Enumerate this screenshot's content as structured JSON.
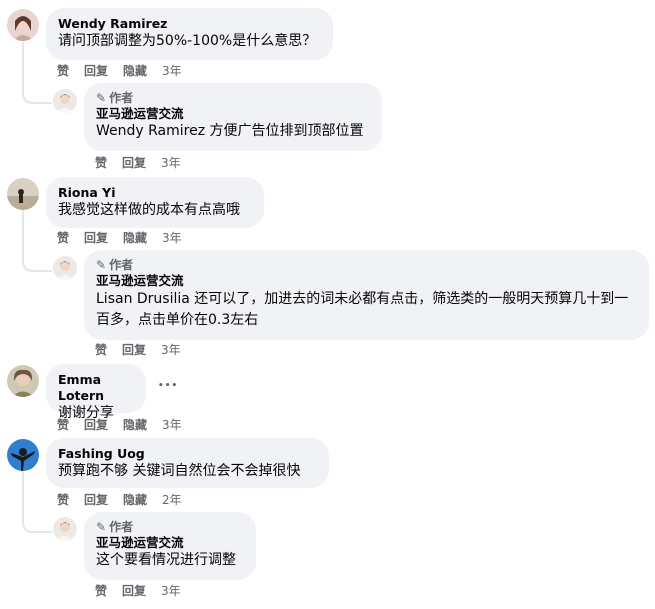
{
  "actions": {
    "like": "赞",
    "reply": "回复",
    "hide": "隐藏"
  },
  "author_badge": "作者",
  "comments": [
    {
      "name": "Wendy Ramirez",
      "text": "请问顶部调整为50%-100%是什么意思？",
      "time": "3年",
      "reply": {
        "name": "亚马逊运营交流",
        "mention": "Wendy Ramirez",
        "text": " 方便广告位排到顶部位置",
        "time": "3年"
      }
    },
    {
      "name": "Riona Yi",
      "text": "我感觉这样做的成本有点高哦",
      "time": "3年",
      "reply": {
        "name": "亚马逊运营交流",
        "mention": "Lisan Drusilia",
        "text": " 还可以了，加进去的词未必都有点击，筛选类的一般明天预算几十到一百多，点击单价在0.3左右",
        "time": "3年"
      }
    },
    {
      "name": "Emma Lotern",
      "text": "谢谢分享",
      "time": "3年",
      "more": "•••"
    },
    {
      "name": "Fashing Uog",
      "text": "预算跑不够 关键词自然位会不会掉很快",
      "time": "2年",
      "reply": {
        "name": "亚马逊运营交流",
        "mention": "",
        "text": "这个要看情况进行调整",
        "time": "3年"
      }
    }
  ]
}
